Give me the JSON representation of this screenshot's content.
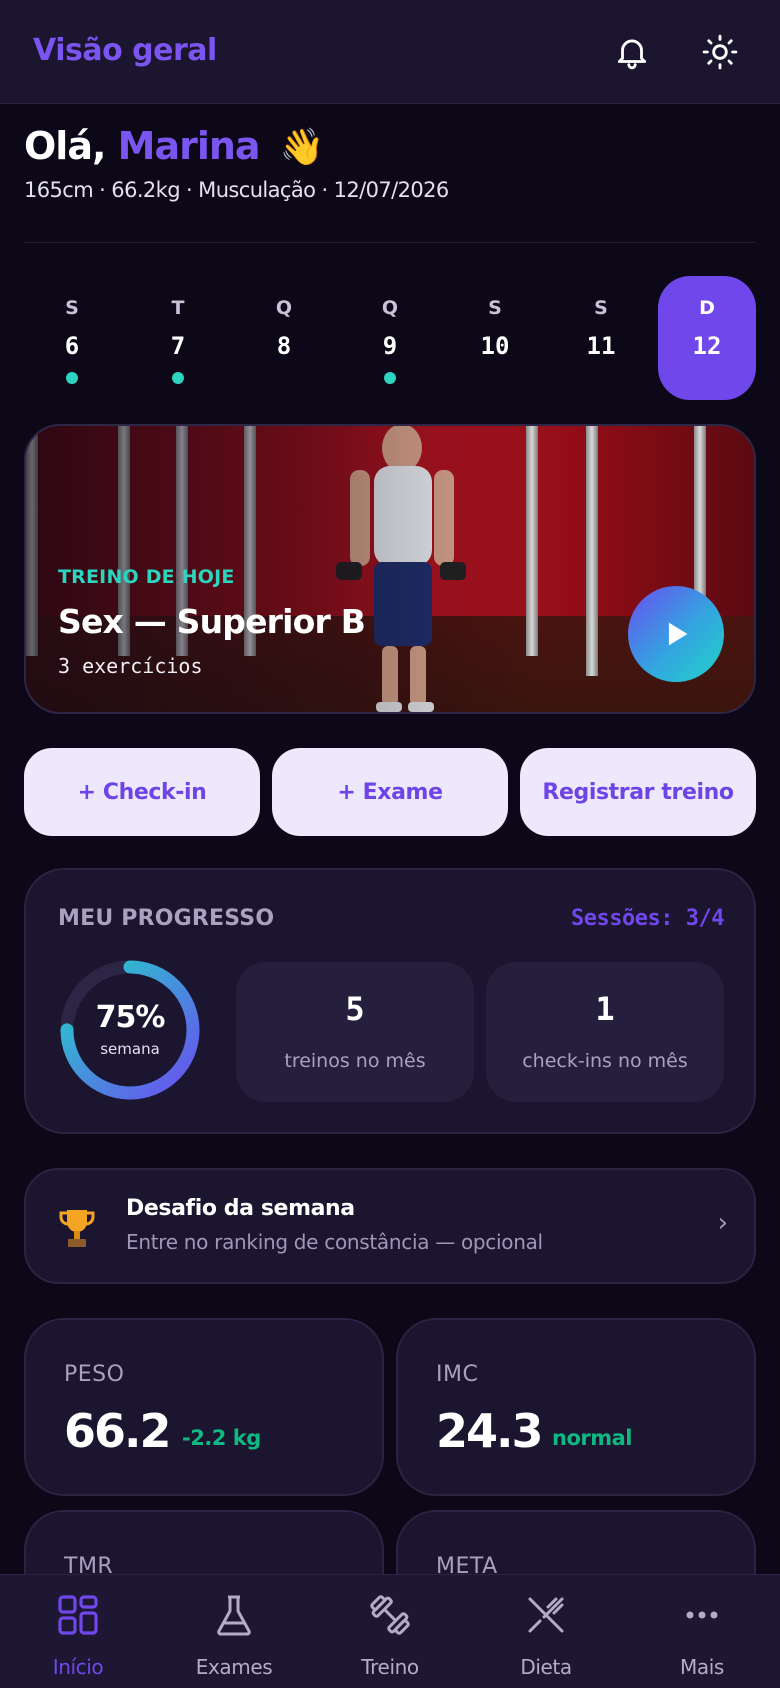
{
  "header": {
    "title": "Visão geral",
    "icons": [
      "bell-icon",
      "sun-icon"
    ]
  },
  "greeting": {
    "prefix": "Olá,",
    "name": "Marina",
    "emoji": "👋"
  },
  "profile_meta": "165cm · 66.2kg · Musculação · 12/07/2026",
  "week": [
    {
      "letter": "S",
      "day": "6",
      "done": true
    },
    {
      "letter": "T",
      "day": "7",
      "done": true
    },
    {
      "letter": "Q",
      "day": "8",
      "done": false
    },
    {
      "letter": "Q",
      "day": "9",
      "done": true
    },
    {
      "letter": "S",
      "day": "10",
      "done": false
    },
    {
      "letter": "S",
      "day": "11",
      "done": false
    },
    {
      "letter": "D",
      "day": "12",
      "done": false,
      "active": true
    }
  ],
  "today_workout": {
    "label": "TREINO DE HOJE",
    "title": "Sex — Superior B",
    "subtitle": "3 exercícios"
  },
  "actions": {
    "checkin": "+ Check-in",
    "exam": "+ Exame",
    "log": "Registrar treino"
  },
  "progress": {
    "label": "MEU PROGRESSO",
    "sessions": "Sessões: 3/4",
    "ring_value": "75%",
    "ring_fraction": 0.75,
    "ring_caption": "semana",
    "workouts_value": "5",
    "workouts_caption": "treinos no mês",
    "checkins_value": "1",
    "checkins_caption": "check-ins no mês"
  },
  "challenge": {
    "title": "Desafio da semana",
    "subtitle": "Entre no ranking de constância — opcional",
    "chevron": "›"
  },
  "stats": {
    "peso": {
      "label": "PESO",
      "value": "66.2",
      "delta": "-2.2 kg"
    },
    "imc": {
      "label": "IMC",
      "value": "24.3",
      "delta": "normal"
    },
    "tmr": {
      "label": "TMR"
    },
    "meta": {
      "label": "META"
    }
  },
  "nav": [
    {
      "label": "Início",
      "icon": "grid-icon",
      "active": true
    },
    {
      "label": "Exames",
      "icon": "flask-icon"
    },
    {
      "label": "Treino",
      "icon": "dumbbell-icon"
    },
    {
      "label": "Dieta",
      "icon": "utensils-icon"
    },
    {
      "label": "Mais",
      "icon": "more-icon"
    }
  ],
  "colors": {
    "accent": "#7047eb",
    "teal": "#2dd4bf",
    "positive": "#10b981",
    "background": "#0c0818",
    "card": "#1b1530"
  }
}
